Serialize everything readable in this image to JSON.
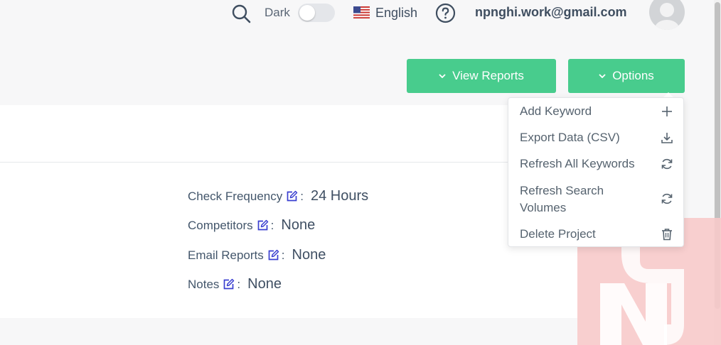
{
  "header": {
    "dark_label": "Dark",
    "language": "English",
    "user_email": "npnghi.work@gmail.com"
  },
  "toolbar": {
    "view_reports_label": "View Reports",
    "options_label": "Options"
  },
  "options_menu": {
    "items": [
      {
        "label": "Add Keyword",
        "icon": "plus-icon"
      },
      {
        "label": "Export Data (CSV)",
        "icon": "download-icon"
      },
      {
        "label": "Refresh All Keywords",
        "icon": "refresh-icon"
      },
      {
        "label": "Refresh Search Volumes",
        "icon": "refresh-icon"
      },
      {
        "label": "Delete Project",
        "icon": "trash-icon"
      }
    ]
  },
  "project_settings": {
    "fields": [
      {
        "label": "Check Frequency",
        "value": "24 Hours"
      },
      {
        "label": "Competitors",
        "value": "None"
      },
      {
        "label": "Email Reports",
        "value": "None"
      },
      {
        "label": "Notes",
        "value": "None"
      }
    ]
  },
  "colors": {
    "accent": "#48cc8d",
    "text": "#43566b",
    "edit_icon": "#3a3fd0"
  }
}
